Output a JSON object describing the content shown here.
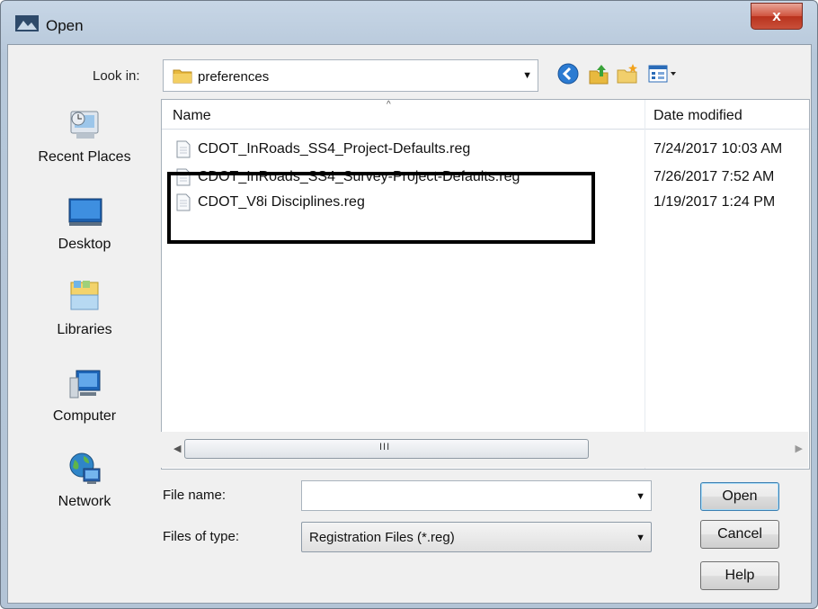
{
  "window": {
    "title": "Open",
    "close_glyph": "x"
  },
  "toolbar": {
    "look_in_label": "Look in:",
    "look_in_value": "preferences",
    "icons": [
      "back-icon",
      "up-folder-icon",
      "new-folder-icon",
      "view-menu-icon"
    ]
  },
  "places": [
    {
      "label": "Recent Places",
      "icon": "recent-places-icon"
    },
    {
      "label": "Desktop",
      "icon": "desktop-icon"
    },
    {
      "label": "Libraries",
      "icon": "libraries-icon"
    },
    {
      "label": "Computer",
      "icon": "computer-icon"
    },
    {
      "label": "Network",
      "icon": "network-icon"
    }
  ],
  "file_list": {
    "columns": {
      "name": "Name",
      "date": "Date modified"
    },
    "files": [
      {
        "name": "CDOT_InRoads_SS4_Project-Defaults.reg",
        "date": "7/24/2017 10:03 AM"
      },
      {
        "name": "CDOT_InRoads_SS4_Survey-Project-Defaults.reg",
        "date": "7/26/2017 7:52 AM"
      },
      {
        "name": "CDOT_V8i Disciplines.reg",
        "date": "1/19/2017 1:24 PM"
      }
    ],
    "scroll_grip": "III"
  },
  "form": {
    "file_name_label": "File name:",
    "file_name_value": "",
    "file_type_label": "Files of type:",
    "file_type_value": "Registration Files (*.reg)"
  },
  "buttons": {
    "open": "Open",
    "cancel": "Cancel",
    "help": "Help"
  },
  "colors": {
    "accent": "#3c7fb1",
    "close": "#c9503a",
    "highlight_border": "#000000"
  }
}
